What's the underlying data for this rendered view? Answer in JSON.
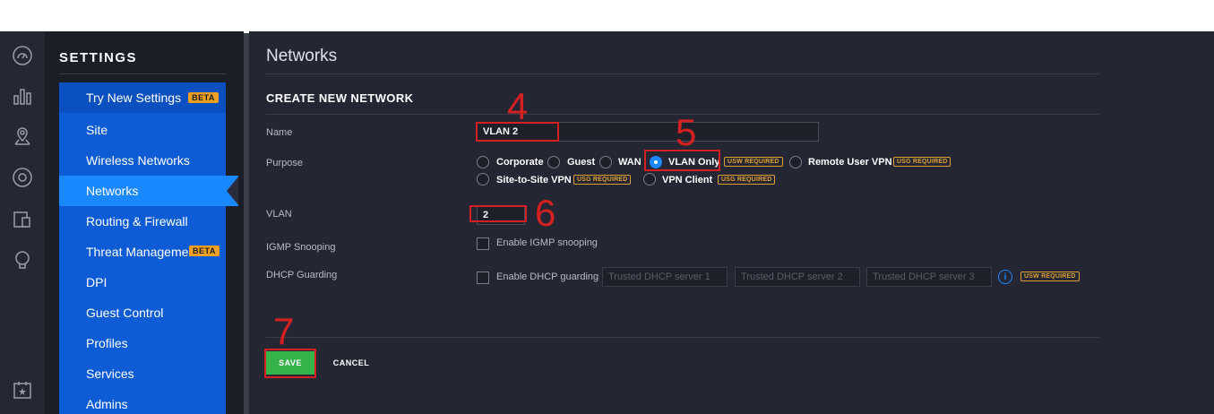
{
  "sidebar": {
    "title": "SETTINGS",
    "items": [
      {
        "label": "Try New Settings",
        "badge": "BETA"
      },
      {
        "label": "Site"
      },
      {
        "label": "Wireless Networks"
      },
      {
        "label": "Networks"
      },
      {
        "label": "Routing & Firewall"
      },
      {
        "label": "Threat Management",
        "badge": "BETA"
      },
      {
        "label": "DPI"
      },
      {
        "label": "Guest Control"
      },
      {
        "label": "Profiles"
      },
      {
        "label": "Services"
      },
      {
        "label": "Admins"
      }
    ]
  },
  "rail": {
    "icons": [
      "dashboard-icon",
      "statistics-icon",
      "map-icon",
      "devices-icon",
      "clients-icon",
      "insights-icon",
      "events-icon"
    ]
  },
  "main": {
    "title": "Networks",
    "section_title": "CREATE NEW NETWORK",
    "fields": {
      "name_label": "Name",
      "name_value": "VLAN 2",
      "purpose_label": "Purpose",
      "vlan_label": "VLAN",
      "vlan_value": "2",
      "igmp_label": "IGMP Snooping",
      "igmp_checkbox": "Enable IGMP snooping",
      "dhcp_label": "DHCP Guarding",
      "dhcp_checkbox": "Enable DHCP guarding",
      "dhcp_server_1": "Trusted DHCP server 1",
      "dhcp_server_2": "Trusted DHCP server 2",
      "dhcp_server_3": "Trusted DHCP server 3",
      "usw_required": "USW REQUIRED"
    },
    "purpose_options": [
      {
        "label": "Corporate",
        "checked": false
      },
      {
        "label": "Guest",
        "checked": false
      },
      {
        "label": "WAN",
        "checked": false
      },
      {
        "label": "VLAN Only",
        "checked": true,
        "badge": "USW REQUIRED"
      },
      {
        "label": "Remote User VPN",
        "checked": false,
        "badge": "USG REQUIRED"
      },
      {
        "label": "Site-to-Site VPN",
        "checked": false,
        "badge": "USG REQUIRED"
      },
      {
        "label": "VPN Client",
        "checked": false,
        "badge": "USG REQUIRED"
      }
    ],
    "buttons": {
      "save": "SAVE",
      "cancel": "CANCEL"
    }
  },
  "annotations": [
    "4",
    "5",
    "6",
    "7"
  ],
  "colors": {
    "accent": "#1a88ff",
    "menu_blue": "#0d5bd5",
    "save_green": "#33b34a",
    "annotation_red": "#d42020",
    "badge_orange": "#e0a030"
  }
}
